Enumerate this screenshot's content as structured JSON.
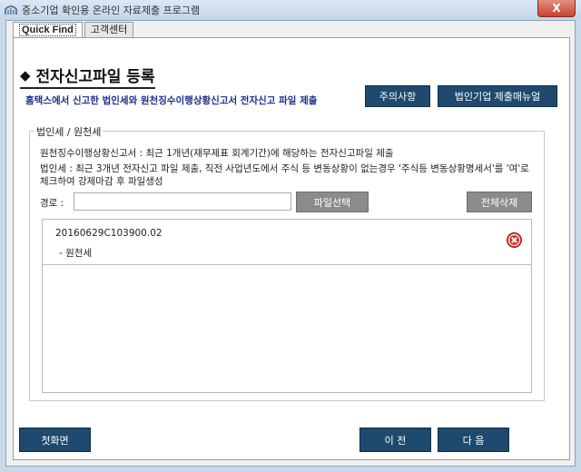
{
  "window": {
    "title": "중소기업 확인용 온라인 자료제출 프로그램",
    "close_label": "X"
  },
  "tabs": [
    {
      "label": "Quick Find",
      "active": true
    },
    {
      "label": "고객센터",
      "active": false
    }
  ],
  "page": {
    "title": "전자신고파일 등록",
    "subtitle": "홈택스에서 신고한 법인세와 원천징수이행상황신고서 전자신고 파일 제출",
    "notice_button": "주의사항",
    "manual_button": "법인기업 제출매뉴얼"
  },
  "section": {
    "title": "법인세 / 원천세",
    "desc_withholding": "원천징수이행상황신고서 : 최근 1개년(재무제표 회계기간)에 해당하는 전자신고파일 제출",
    "desc_corporate": "법인세 : 최근 3개년 전자신고 파일 제출, 직전 사업년도에서 주식 등 변동상황이 없는경우 '주식등 변동상황명세서'를 '여'로 체크하여 강제마감 후 파일생성",
    "path_label": "경로 :",
    "path_value": "",
    "select_file_button": "파일선택",
    "delete_all_button": "전체삭제"
  },
  "files": [
    {
      "name": "20160629C103900.02",
      "type": "- 원천세"
    }
  ],
  "footer": {
    "home_button": "첫화면",
    "prev_button": "이 전",
    "next_button": "다 음"
  },
  "colors": {
    "navy_button": "#1d4a6e",
    "gray_button": "#8b8b8b",
    "subtitle_text": "#1b2f8a",
    "remove_icon": "#d9312b"
  },
  "icons": {
    "app": "app-icon",
    "remove": "remove-file-icon"
  }
}
